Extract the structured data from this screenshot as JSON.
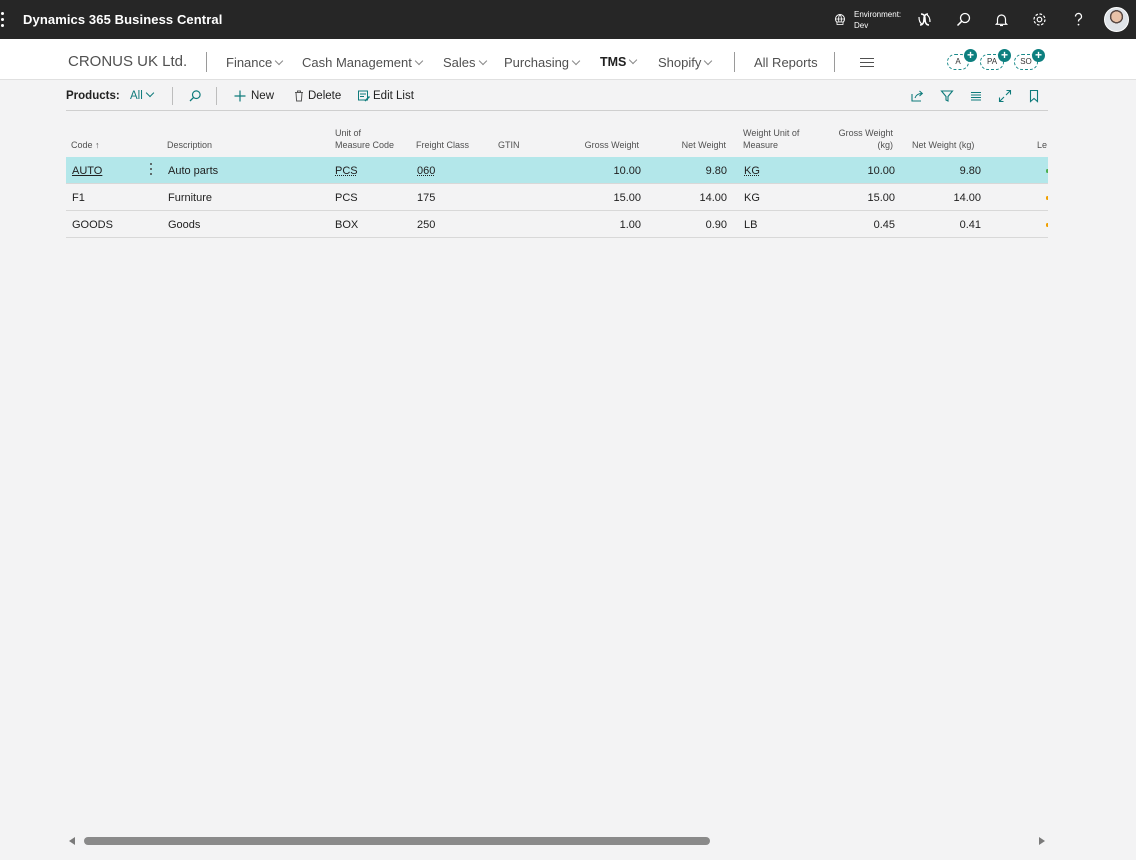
{
  "app": {
    "title": "Dynamics 365 Business Central"
  },
  "environment": {
    "label": "Environment:",
    "value": "Dev"
  },
  "navbar": {
    "company": "CRONUS UK Ltd.",
    "items": [
      {
        "label": "Finance"
      },
      {
        "label": "Cash Management"
      },
      {
        "label": "Sales"
      },
      {
        "label": "Purchasing"
      },
      {
        "label": "TMS"
      },
      {
        "label": "Shopify"
      }
    ],
    "all_reports": "All Reports",
    "badges": [
      "A",
      "PA",
      "SO"
    ]
  },
  "actionbar": {
    "page_caption": "Products:",
    "view": "All",
    "new_label": "New",
    "delete_label": "Delete",
    "edit_list_label": "Edit List"
  },
  "table": {
    "headers": {
      "code": "Code",
      "description": "Description",
      "uom_code_1": "Unit of",
      "uom_code_2": "Measure Code",
      "freight_class": "Freight Class",
      "gtin": "GTIN",
      "gross_weight": "Gross Weight",
      "net_weight": "Net Weight",
      "weight_uom_1": "Weight Unit of",
      "weight_uom_2": "Measure",
      "gross_kg_1": "Gross Weight",
      "gross_kg_2": "(kg)",
      "net_kg": "Net Weight (kg)",
      "truncated": "Le"
    },
    "sort_indicator": "↑",
    "rows": [
      {
        "code": "AUTO",
        "description": "Auto parts",
        "uom": "PCS",
        "freight_class": "060",
        "gtin": "",
        "gross_weight": "10.00",
        "net_weight": "9.80",
        "weight_uom": "KG",
        "gross_kg": "10.00",
        "net_kg": "9.80"
      },
      {
        "code": "F1",
        "description": "Furniture",
        "uom": "PCS",
        "freight_class": "175",
        "gtin": "",
        "gross_weight": "15.00",
        "net_weight": "14.00",
        "weight_uom": "KG",
        "gross_kg": "15.00",
        "net_kg": "14.00"
      },
      {
        "code": "GOODS",
        "description": "Goods",
        "uom": "BOX",
        "freight_class": "250",
        "gtin": "",
        "gross_weight": "1.00",
        "net_weight": "0.90",
        "weight_uom": "LB",
        "gross_kg": "0.45",
        "net_kg": "0.41"
      }
    ]
  },
  "colors": {
    "accent": "#0f7b7b",
    "selected_row": "#b3e7ea",
    "topbar": "#262626",
    "edge_green": "#4caf50",
    "edge_orange": "#f0a000"
  }
}
